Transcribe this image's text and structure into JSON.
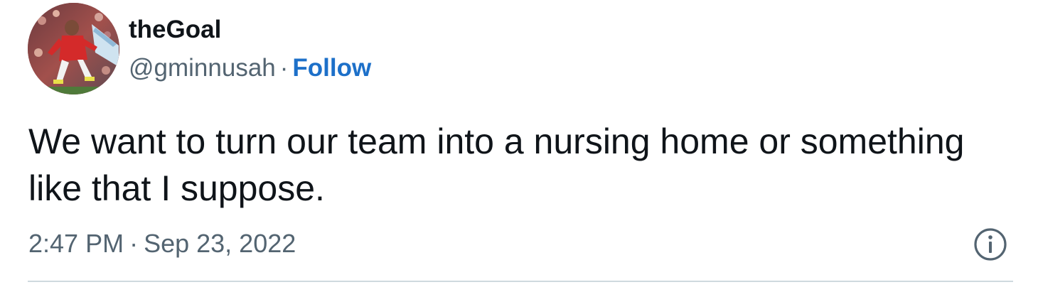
{
  "tweet": {
    "author": {
      "display_name": "theGoal",
      "handle": "@gminnusah",
      "separator": "·",
      "follow_label": "Follow",
      "avatar_icon": "profile-photo"
    },
    "text": "We want to turn our team into a nursing home or something like that I suppose.",
    "meta": {
      "time": "2:47 PM",
      "separator": "·",
      "date": "Sep 23, 2022",
      "info_icon": "info-icon"
    }
  },
  "colors": {
    "text_primary": "#0f1419",
    "text_secondary": "#536471",
    "link_accent": "#1d70c9",
    "divider": "#cfd9de"
  }
}
